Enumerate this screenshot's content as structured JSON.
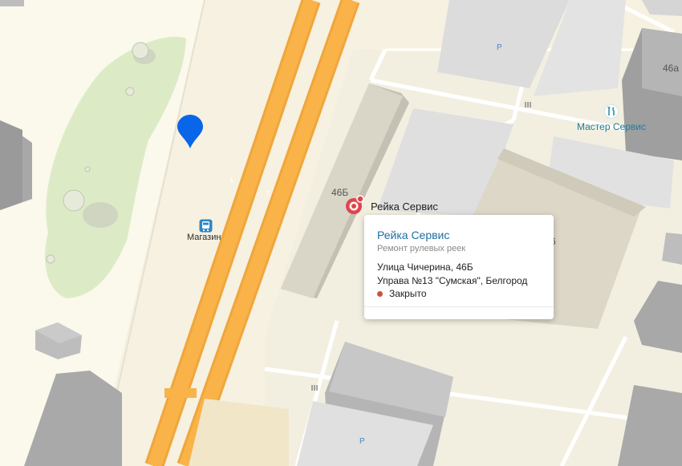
{
  "map": {
    "location_marker": {
      "icon": "location-pin-icon",
      "color": "#0a66e8"
    },
    "bus_stop": {
      "label": "Магазин",
      "icon": "bus-stop-icon"
    },
    "buildings": {
      "b46b": "46Б",
      "b46a": "46а",
      "partial_6": "6"
    },
    "parking": {
      "p1": "P",
      "p2": "P"
    },
    "poi_master": {
      "label": "Мастер Сервис",
      "icon": "tools-icon"
    },
    "poi_selected": {
      "label": "Рейка Сервис",
      "icon": "auto-service-pin-icon",
      "color": "#e0454b"
    }
  },
  "card": {
    "title": "Рейка Сервис",
    "subtitle": "Ремонт рулевых реек",
    "address_line1": "Улица Чичерина, 46Б",
    "address_line2": "Управа №13 \"Сумская\", Белгород",
    "status": "Закрыто",
    "status_color": "#d1523b"
  }
}
